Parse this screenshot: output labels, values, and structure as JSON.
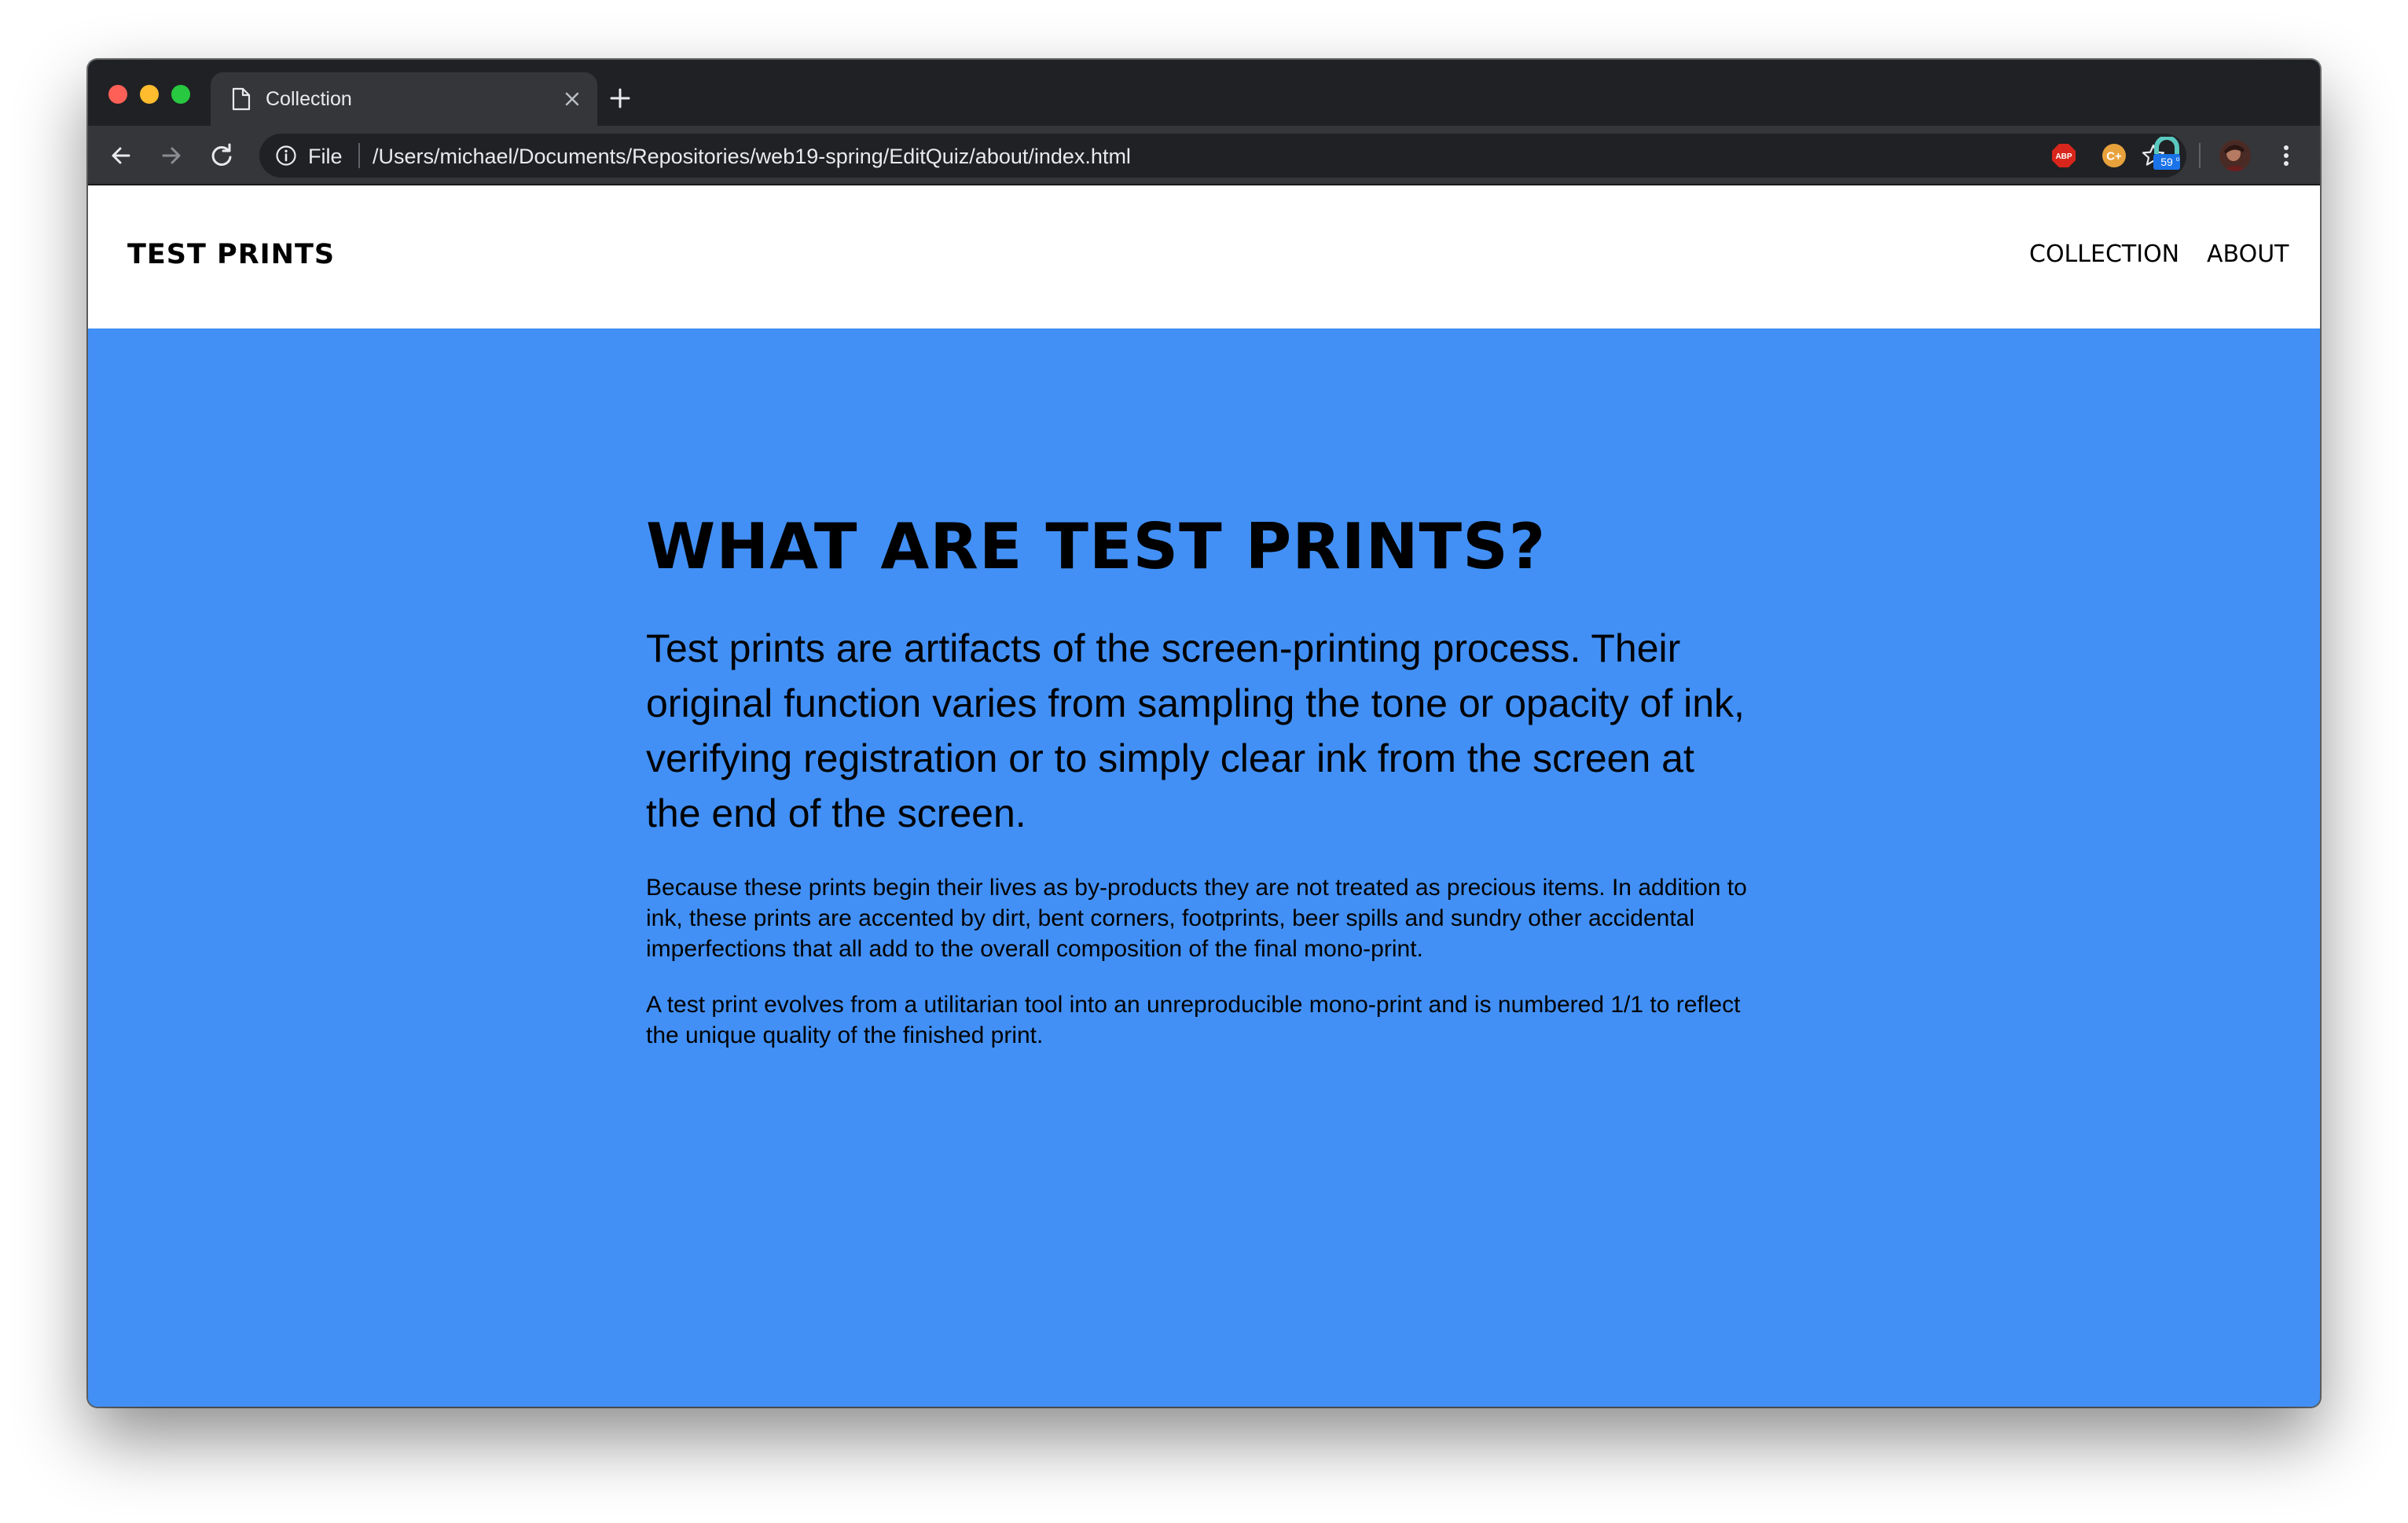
{
  "browser": {
    "tab": {
      "title": "Collection"
    },
    "omnibox": {
      "scheme_label": "File",
      "url": "/Users/michael/Documents/Repositories/web19-spring/EditQuiz/about/index.html"
    },
    "extensions": [
      {
        "name": "adblock-plus-icon",
        "label": "ABP"
      },
      {
        "name": "c-plus-icon",
        "label": "C+"
      },
      {
        "name": "lock-extension-icon",
        "badge": "59"
      }
    ]
  },
  "site": {
    "brand": "TEST PRINTS",
    "nav": [
      {
        "label": "COLLECTION"
      },
      {
        "label": "ABOUT"
      }
    ]
  },
  "article": {
    "heading": "WHAT ARE TEST PRINTS?",
    "lead": "Test prints are artifacts of the screen-printing process. Their original function varies from sampling the tone or opacity of ink, verifying registration or to simply clear ink from the screen at the end of the screen.",
    "paragraphs": [
      "Because these prints begin their lives as by-products they are not treated as precious items. In addition to ink, these prints are accented by dirt, bent corners, footprints, beer spills and sundry other accidental imperfections that all add to the overall composition of the final mono-print.",
      "A test print evolves from a utilitarian tool into an unreproducible mono-print and is numbered 1/1 to reflect the unique quality of the finished print."
    ]
  },
  "colors": {
    "page_background": "#4290f5",
    "header_background": "#ffffff",
    "browser_chrome": "#202124",
    "toolbar": "#35363a"
  }
}
